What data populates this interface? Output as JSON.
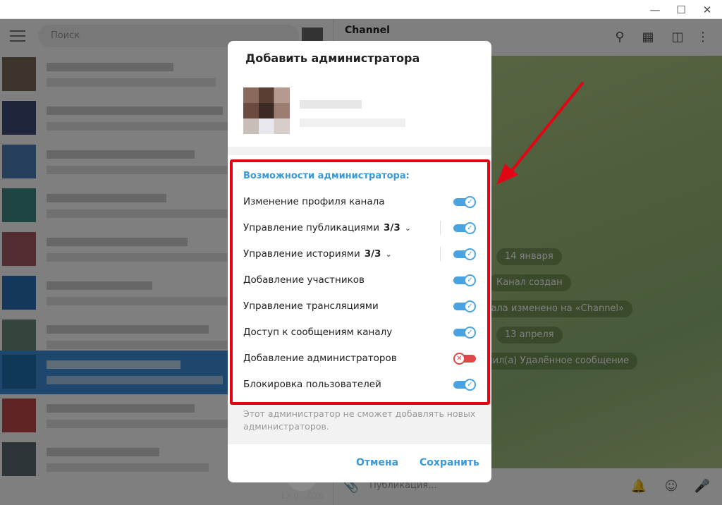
{
  "window": {
    "minimize": "—",
    "maximize": "☐",
    "close": "✕"
  },
  "sidebar": {
    "search_placeholder": "Поиск",
    "timestamp_partial": "13.0…026"
  },
  "chat": {
    "title": "Channel",
    "service_messages": [
      "14 января",
      "Канал создан",
      "нала изменено на «Channel»",
      "13 апреля",
      "пил(а) Удалённое сообщение"
    ],
    "composer_placeholder": "Публикация..."
  },
  "dialog": {
    "title": "Добавить администратора",
    "section_title": "Возможности администратора:",
    "permissions": [
      {
        "label": "Изменение профиля канала",
        "count": "",
        "expandable": false,
        "enabled": true
      },
      {
        "label": "Управление публикациями",
        "count": "3/3",
        "expandable": true,
        "enabled": true
      },
      {
        "label": "Управление историями",
        "count": "3/3",
        "expandable": true,
        "enabled": true
      },
      {
        "label": "Добавление участников",
        "count": "",
        "expandable": false,
        "enabled": true
      },
      {
        "label": "Управление трансляциями",
        "count": "",
        "expandable": false,
        "enabled": true
      },
      {
        "label": "Доступ к сообщениям каналу",
        "count": "",
        "expandable": false,
        "enabled": true
      },
      {
        "label": "Добавление администраторов",
        "count": "",
        "expandable": false,
        "enabled": false
      },
      {
        "label": "Блокировка пользователей",
        "count": "",
        "expandable": false,
        "enabled": true
      }
    ],
    "note": "Этот администратор не сможет добавлять новых администраторов.",
    "cancel_label": "Отмена",
    "save_label": "Сохранить"
  },
  "colors": {
    "accent": "#3a9ad8",
    "toggle_on": "#49a3e0",
    "toggle_off": "#e0474a",
    "highlight": "#e00614"
  }
}
